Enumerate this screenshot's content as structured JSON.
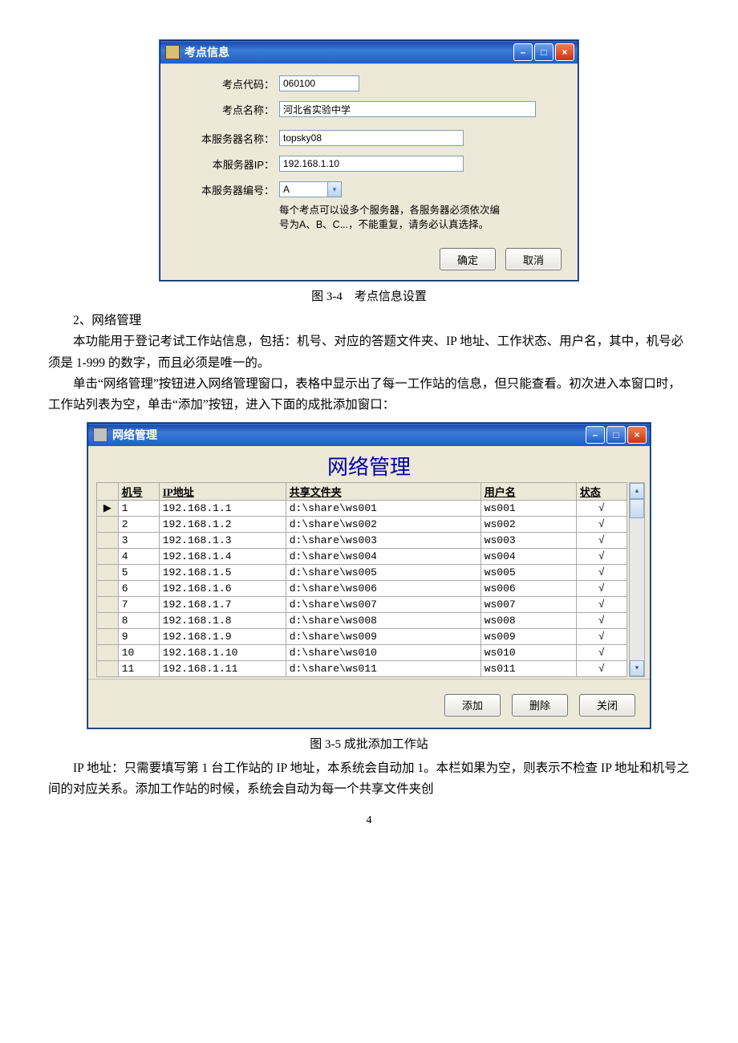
{
  "dialog1": {
    "window_title": "考点信息",
    "fields": {
      "code_label": "考点代码：",
      "code_value": "060100",
      "name_label": "考点名称：",
      "name_value": "河北省实验中学",
      "server_name_label": "本服务器名称：",
      "server_name_value": "topsky08",
      "server_ip_label": "本服务器IP：",
      "server_ip_value": "192.168.1.10",
      "server_no_label": "本服务器编号：",
      "server_no_value": "A",
      "hint_line1": "每个考点可以设多个服务器，各服务器必须依次编",
      "hint_line2": "号为A、B、C...，不能重复，请务必认真选择。"
    },
    "buttons": {
      "ok": "确定",
      "cancel": "取消"
    }
  },
  "caption1": "图 3-4　考点信息设置",
  "para1": "2、网络管理",
  "para2": "本功能用于登记考试工作站信息，包括：机号、对应的答题文件夹、IP 地址、工作状态、用户名，其中，机号必须是 1-999 的数字，而且必须是唯一的。",
  "para3": "单击“网络管理”按钮进入网络管理窗口，表格中显示出了每一工作站的信息，但只能查看。初次进入本窗口时，工作站列表为空，单击“添加”按钮，进入下面的成批添加窗口：",
  "dialog2": {
    "window_title": "网络管理",
    "panel_title": "网络管理",
    "headers": {
      "num": "机号",
      "ip": "IP地址",
      "share": "共享文件夹",
      "user": "用户名",
      "status": "状态"
    },
    "rows": [
      {
        "sel": "▶",
        "num": "1",
        "ip": "192.168.1.1",
        "share": "d:\\share\\ws001",
        "user": "ws001",
        "status": "√"
      },
      {
        "sel": "",
        "num": "2",
        "ip": "192.168.1.2",
        "share": "d:\\share\\ws002",
        "user": "ws002",
        "status": "√"
      },
      {
        "sel": "",
        "num": "3",
        "ip": "192.168.1.3",
        "share": "d:\\share\\ws003",
        "user": "ws003",
        "status": "√"
      },
      {
        "sel": "",
        "num": "4",
        "ip": "192.168.1.4",
        "share": "d:\\share\\ws004",
        "user": "ws004",
        "status": "√"
      },
      {
        "sel": "",
        "num": "5",
        "ip": "192.168.1.5",
        "share": "d:\\share\\ws005",
        "user": "ws005",
        "status": "√"
      },
      {
        "sel": "",
        "num": "6",
        "ip": "192.168.1.6",
        "share": "d:\\share\\ws006",
        "user": "ws006",
        "status": "√"
      },
      {
        "sel": "",
        "num": "7",
        "ip": "192.168.1.7",
        "share": "d:\\share\\ws007",
        "user": "ws007",
        "status": "√"
      },
      {
        "sel": "",
        "num": "8",
        "ip": "192.168.1.8",
        "share": "d:\\share\\ws008",
        "user": "ws008",
        "status": "√"
      },
      {
        "sel": "",
        "num": "9",
        "ip": "192.168.1.9",
        "share": "d:\\share\\ws009",
        "user": "ws009",
        "status": "√"
      },
      {
        "sel": "",
        "num": "10",
        "ip": "192.168.1.10",
        "share": "d:\\share\\ws010",
        "user": "ws010",
        "status": "√"
      },
      {
        "sel": "",
        "num": "11",
        "ip": "192.168.1.11",
        "share": "d:\\share\\ws011",
        "user": "ws011",
        "status": "√"
      }
    ],
    "buttons": {
      "add": "添加",
      "delete": "删除",
      "close": "关闭"
    }
  },
  "caption2": "图 3-5  成批添加工作站",
  "para4": "IP 地址：只需要填写第 1 台工作站的 IP 地址，本系统会自动加 1。本栏如果为空，则表示不检查 IP 地址和机号之间的对应关系。添加工作站的时候，系统会自动为每一个共享文件夹创",
  "page_number": "4"
}
